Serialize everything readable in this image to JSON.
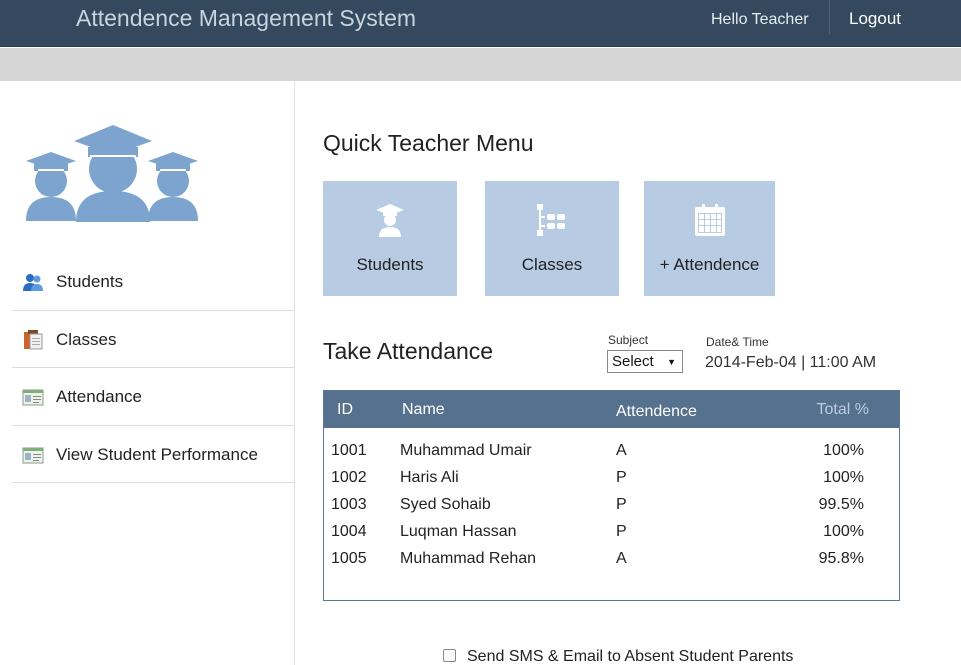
{
  "header": {
    "title": "Attendence Management System",
    "greeting": "Hello Teacher",
    "logout_label": "Logout"
  },
  "sidebar": {
    "items": [
      {
        "label": "Students",
        "icon": "students-icon"
      },
      {
        "label": "Classes",
        "icon": "clipboard-icon"
      },
      {
        "label": "Attendance",
        "icon": "id-card-icon"
      },
      {
        "label": "View Student Performance",
        "icon": "id-card-icon"
      }
    ]
  },
  "quick_menu": {
    "title": "Quick Teacher Menu",
    "tiles": [
      {
        "label": "Students",
        "icon": "graduate-icon"
      },
      {
        "label": "Classes",
        "icon": "hierarchy-icon"
      },
      {
        "label": "+ Attendence",
        "icon": "calendar-icon"
      }
    ]
  },
  "attendance": {
    "title": "Take Attendance",
    "subject_label": "Subject",
    "subject_value": "Select",
    "datetime_label": "Date& Time",
    "datetime_value": "2014-Feb-04 | 11:00 AM",
    "columns": [
      "ID",
      "Name",
      "Attendence",
      "Total %"
    ],
    "rows": [
      {
        "id": "1001",
        "name": "Muhammad Umair",
        "attendance": "A",
        "total": "100%"
      },
      {
        "id": "1002",
        "name": "Haris Ali",
        "attendance": "P",
        "total": "100%"
      },
      {
        "id": "1003",
        "name": "Syed Sohaib",
        "attendance": "P",
        "total": "99.5%"
      },
      {
        "id": "1004",
        "name": "Luqman Hassan",
        "attendance": "P",
        "total": "100%"
      },
      {
        "id": "1005",
        "name": "Muhammad Rehan",
        "attendance": "A",
        "total": "95.8%"
      }
    ]
  },
  "sms": {
    "label": "Send SMS & Email to Absent Student Parents",
    "checked": false
  },
  "colors": {
    "header_bg": "#34495e",
    "tile_bg": "#b7cbe3",
    "table_header_bg": "#56718d",
    "logo_color": "#7da4cf"
  }
}
